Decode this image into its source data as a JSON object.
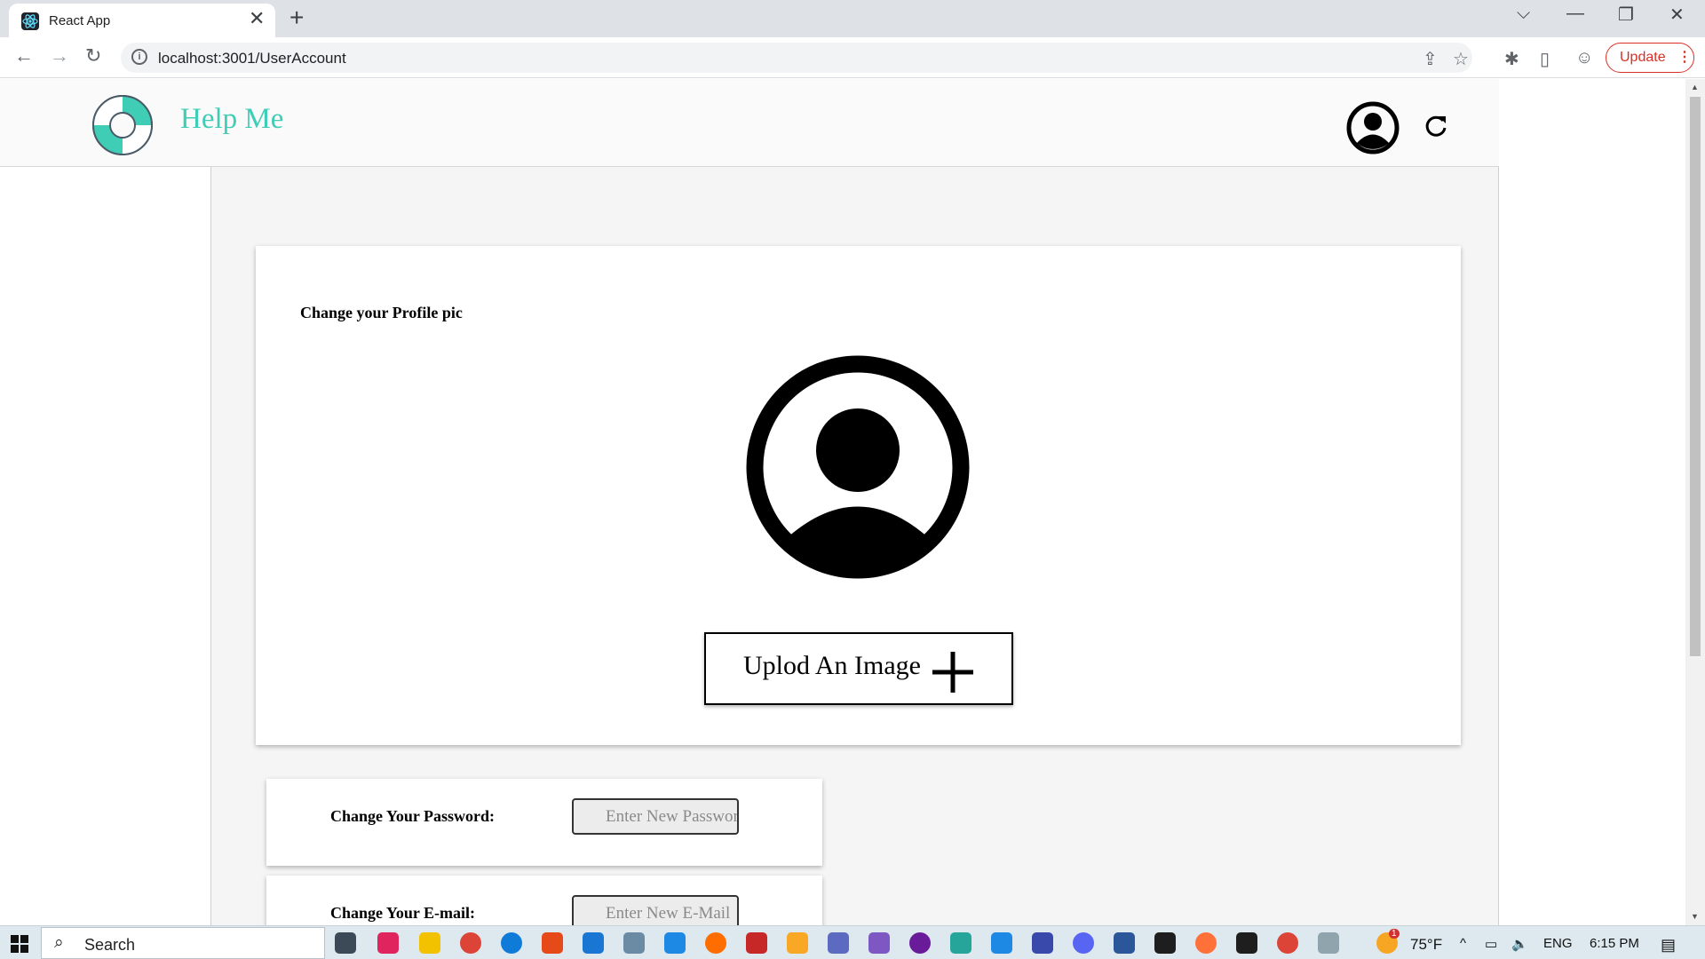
{
  "browser": {
    "tab_title": "React App",
    "tab_close": "✕",
    "new_tab": "+",
    "url": "localhost:3001/UserAccount",
    "update_label": "Update",
    "window_controls": {
      "dropdown": "⌵",
      "minimize": "—",
      "restore": "❐",
      "close": "✕"
    }
  },
  "app": {
    "brand": "Help Me",
    "accent_color": "#3fcdb6"
  },
  "profile_pic": {
    "title": "Change your Profile pic",
    "upload_label": "Uplod An Image"
  },
  "password": {
    "label": "Change Your Password:",
    "placeholder": "Enter New Password"
  },
  "email": {
    "label": "Change Your E-mail:",
    "placeholder": "Enter New E-Mail"
  },
  "taskbar": {
    "search_label": "Search",
    "weather": "75°F",
    "language": "ENG",
    "time": "6:15 PM",
    "weather_badge": "1"
  }
}
